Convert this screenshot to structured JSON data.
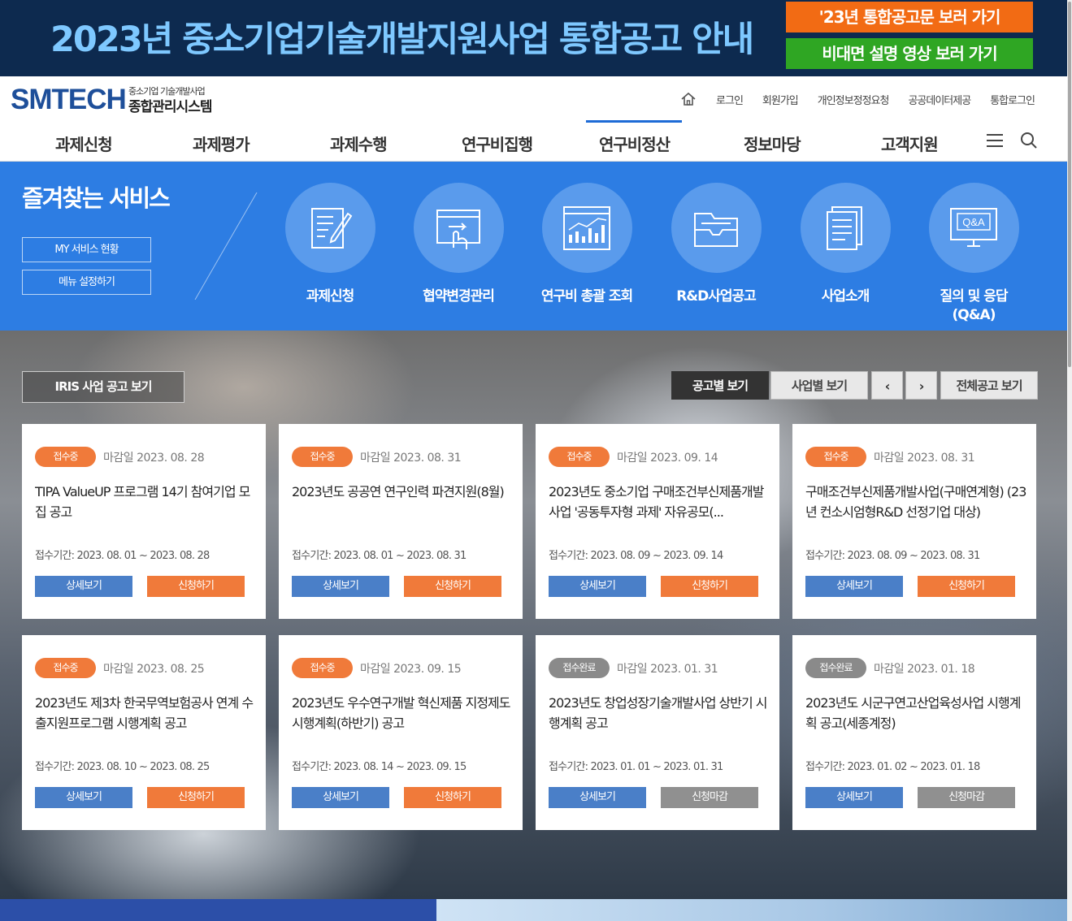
{
  "banner": {
    "title": "2023년 중소기업기술개발지원사업 통합공고 안내",
    "btn_notice": "'23년 통합공고문 보러 가기",
    "btn_video": "비대면 설명 영상 보러 가기"
  },
  "header": {
    "logo": "SMTECH",
    "logo_sub1": "중소기업 기술개발사업",
    "logo_sub2": "종합관리시스템",
    "util": [
      "로그인",
      "회원가입",
      "개인정보정정요청",
      "공공데이터제공",
      "통합로그인"
    ]
  },
  "gnb": [
    "과제신청",
    "과제평가",
    "과제수행",
    "연구비집행",
    "연구비정산",
    "정보마당",
    "고객지원"
  ],
  "quick": {
    "title": "즐겨찾는 서비스",
    "btn_my": "MY 서비스 현황",
    "btn_menu": "메뉴 설정하기",
    "items": [
      {
        "label": "과제신청",
        "label2": ""
      },
      {
        "label": "협약변경관리",
        "label2": ""
      },
      {
        "label": "연구비 총괄 조회",
        "label2": ""
      },
      {
        "label": "R&D사업공고",
        "label2": ""
      },
      {
        "label": "사업소개",
        "label2": ""
      },
      {
        "label": "질의 및 응답",
        "label2": "(Q&A)"
      }
    ]
  },
  "notices": {
    "iris_btn": "IRIS 사업 공고 보기",
    "tab_notice": "공고별 보기",
    "tab_business": "사업별 보기",
    "prev": "‹",
    "next": "›",
    "all": "전체공고 보기",
    "detail_label": "상세보기",
    "cards": [
      {
        "status": "접수중",
        "deadline": "마감일 2023. 08. 28",
        "title": "TIPA ValueUP 프로그램 14기 참여기업 모집 공고",
        "period": "접수기간: 2023. 08. 01 ~ 2023. 08. 28",
        "action": "신청하기"
      },
      {
        "status": "접수중",
        "deadline": "마감일 2023. 08. 31",
        "title": "2023년도 공공연 연구인력 파견지원(8월)",
        "period": "접수기간: 2023. 08. 01 ~ 2023. 08. 31",
        "action": "신청하기"
      },
      {
        "status": "접수중",
        "deadline": "마감일 2023. 09. 14",
        "title": "2023년도 중소기업 구매조건부신제품개발사업 '공동투자형 과제' 자유공모(...",
        "period": "접수기간: 2023. 08. 09 ~ 2023. 09. 14",
        "action": "신청하기"
      },
      {
        "status": "접수중",
        "deadline": "마감일 2023. 08. 31",
        "title": "구매조건부신제품개발사업(구매연계형) (23년 컨소시엄형R&D 선정기업 대상)",
        "period": "접수기간: 2023. 08. 09 ~ 2023. 08. 31",
        "action": "신청하기"
      },
      {
        "status": "접수중",
        "deadline": "마감일 2023. 08. 25",
        "title": "2023년도 제3차 한국무역보험공사 연계 수출지원프로그램 시행계획 공고",
        "period": "접수기간: 2023. 08. 10 ~ 2023. 08. 25",
        "action": "신청하기"
      },
      {
        "status": "접수중",
        "deadline": "마감일 2023. 09. 15",
        "title": "2023년도 우수연구개발 혁신제품 지정제도 시행계획(하반기) 공고",
        "period": "접수기간: 2023. 08. 14 ~ 2023. 09. 15",
        "action": "신청하기"
      },
      {
        "status": "접수완료",
        "deadline": "마감일 2023. 01. 31",
        "title": "2023년도 창업성장기술개발사업 상반기 시행계획 공고",
        "period": "접수기간: 2023. 01. 01 ~ 2023. 01. 31",
        "action": "신청마감"
      },
      {
        "status": "접수완료",
        "deadline": "마감일 2023. 01. 18",
        "title": "2023년도 시군구연고산업육성사업 시행계획 공고(세종계정)",
        "period": "접수기간: 2023. 01. 02 ~ 2023. 01. 18",
        "action": "신청마감"
      }
    ]
  }
}
